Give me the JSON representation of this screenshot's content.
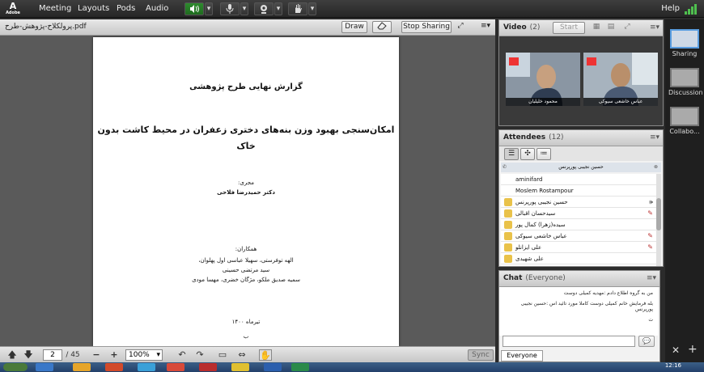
{
  "menubar": {
    "logo_main": "A",
    "logo_sub": "Adobe",
    "menus": [
      "Meeting",
      "Layouts",
      "Pods",
      "Audio"
    ],
    "help": "Help"
  },
  "share_pod": {
    "file_name": "پرولکلاح-پژوهش-طرح.pdf",
    "draw": "Draw",
    "stop_sharing": "Stop Sharing",
    "page_current": "2",
    "page_total": "/ 45",
    "zoom": "100%",
    "sync": "Sync"
  },
  "document": {
    "report_title": "گزارش نهایی طرح پژوهشی",
    "main_title_1": "امکان‌سنجی بهبود وزن بنه‌های دختری زعفران در محیط کاشت بدون",
    "main_title_2": "خاک",
    "executor_label": "مجری:",
    "executor_name": "دکتر حمیدرضا فلاحی",
    "collaborators_label": "همکاران:",
    "collaborators_1": "الهه توفرستی، سهیلا عباسی اول پهلوان،",
    "collaborators_2": "سید مرتضی حسینی",
    "collaborators_3": "سمیه صدیق ملکو، مژگان خضری، مهسا مودی",
    "date": "تیرماه ۱۴۰۰",
    "page_number": "ب"
  },
  "video_pod": {
    "title": "Video",
    "count": "(2)",
    "start": "Start",
    "participants": [
      "محمود خلیلیان",
      "عباس خاشعی سیوکی"
    ]
  },
  "attendees_pod": {
    "title": "Attendees",
    "count": "(12)",
    "selected": "حسین نجیبی پورپرنس",
    "list": [
      "aminifard",
      "Moslem Rostampour",
      "حسین نجیبی پورپرنس",
      "سیدحسان اقبالی",
      "سیده(زهرا) کمال پور",
      "عباس خاشعی سیوکی",
      "علی ایزانلو",
      "علی شهیدی"
    ]
  },
  "chat_pod": {
    "title": "Chat",
    "scope": "(Everyone)",
    "messages": [
      "من به گروه اطلاع دادم :مهدیه کمیلی دوست",
      "بله فرمایش خانم کمیلی دوست کاملا مورد تائید اس :حسین نجیبی پورپرنس",
      "ت"
    ],
    "tab": "Everyone"
  },
  "layouts": [
    "Sharing",
    "Discussion",
    "Collabo..."
  ],
  "taskbar": {
    "clock_time": "12:16"
  },
  "colors": {
    "accent_blue": "#5a9de0",
    "audio_green": "#2e8b2e",
    "signal_green": "#4fc04f"
  }
}
